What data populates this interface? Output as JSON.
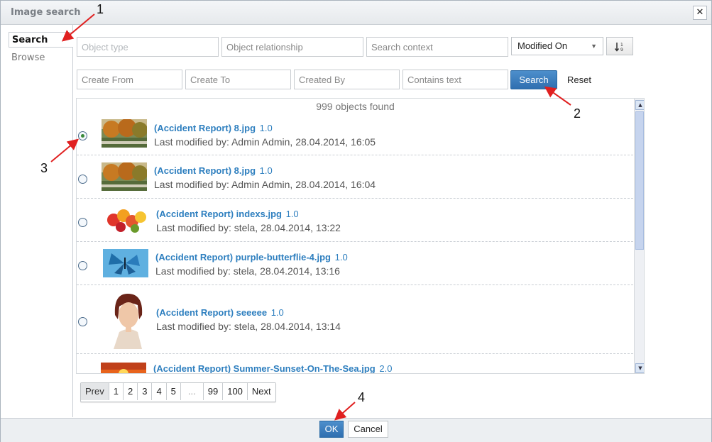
{
  "window": {
    "title": "Image search",
    "close_icon": "close-icon"
  },
  "nav": {
    "tabs": [
      {
        "label": "Search",
        "active": true
      },
      {
        "label": "Browse",
        "active": false
      }
    ]
  },
  "filters": {
    "object_type": "Object type",
    "object_relationship": "Object relationship",
    "search_context": "Search context",
    "sort_field": "Modified On",
    "sort_icon": "sort-order-icon",
    "create_from": "Create From",
    "create_to": "Create To",
    "created_by": "Created By",
    "contains_text": "Contains text",
    "search_label": "Search",
    "reset_label": "Reset"
  },
  "results": {
    "count_text": "999 objects found",
    "items": [
      {
        "title": "(Accident Report) 8.jpg",
        "version": "1.0",
        "meta": "Last modified by: Admin Admin, 28.04.2014, 16:05",
        "selected": true,
        "thumb": "autumn-park"
      },
      {
        "title": "(Accident Report) 8.jpg",
        "version": "1.0",
        "meta": "Last modified by: Admin Admin, 28.04.2014, 16:04",
        "selected": false,
        "thumb": "autumn-park"
      },
      {
        "title": "(Accident Report) indexs.jpg",
        "version": "1.0",
        "meta": "Last modified by: stela, 28.04.2014, 13:22",
        "selected": false,
        "thumb": "flowers"
      },
      {
        "title": "(Accident Report) purple-butterflie-4.jpg",
        "version": "1.0",
        "meta": "Last modified by: stela, 28.04.2014, 13:16",
        "selected": false,
        "thumb": "butterfly"
      },
      {
        "title": "(Accident Report) seeeee",
        "version": "1.0",
        "meta": "Last modified by: stela, 28.04.2014, 13:14",
        "selected": false,
        "thumb": "portrait"
      },
      {
        "title": "(Accident Report) Summer-Sunset-On-The-Sea.jpg",
        "version": "2.0",
        "meta": "",
        "selected": false,
        "thumb": "sunset"
      }
    ]
  },
  "pagination": {
    "prev": "Prev",
    "pages": [
      "1",
      "2",
      "3",
      "4",
      "5",
      "...",
      "99",
      "100"
    ],
    "next": "Next"
  },
  "footer": {
    "ok_label": "OK",
    "cancel_label": "Cancel"
  },
  "annotations": [
    "1",
    "2",
    "3",
    "4"
  ],
  "colors": {
    "accent": "#2e7fbf",
    "button_primary": "#3a7cbd",
    "arrow": "#e02020"
  }
}
